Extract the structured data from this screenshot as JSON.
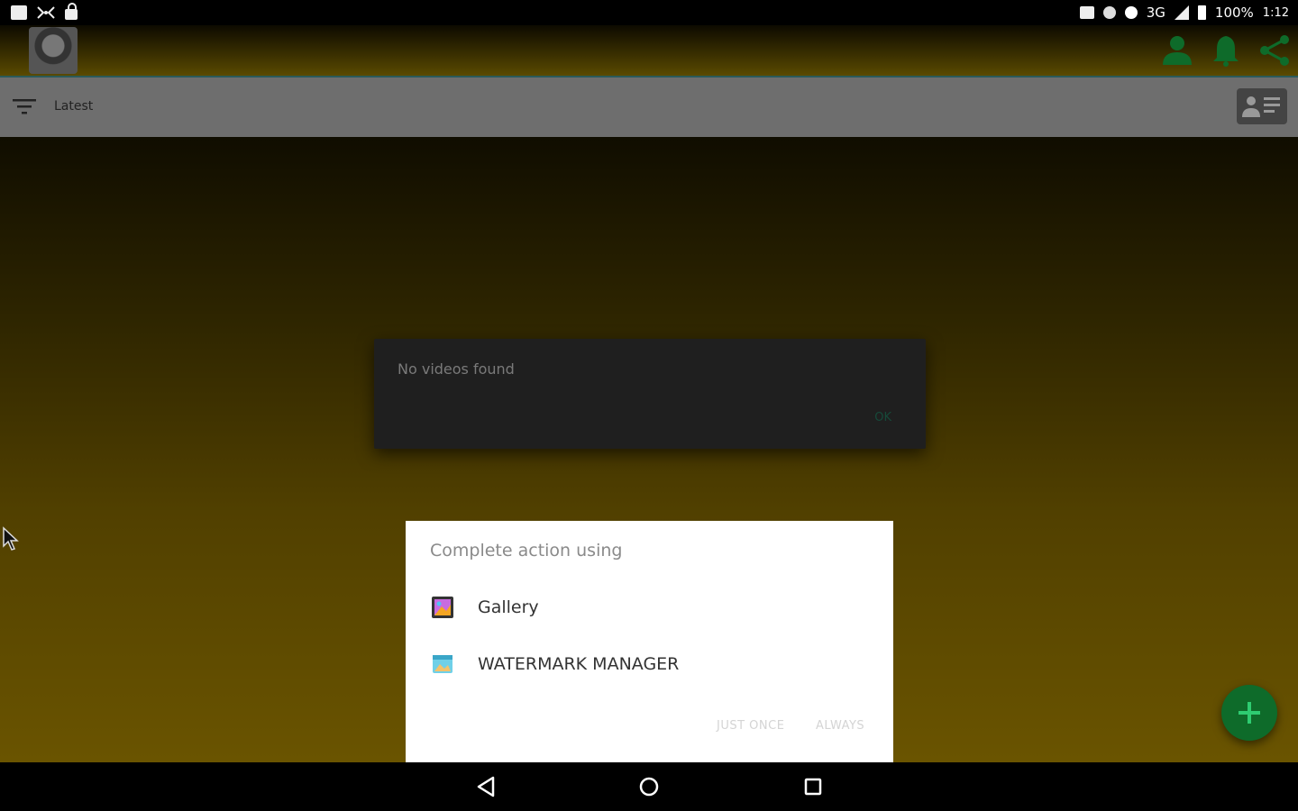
{
  "status_bar": {
    "network": "3G",
    "battery": "100%",
    "time": "1:12"
  },
  "filter_bar": {
    "sort_label": "Latest"
  },
  "alert": {
    "message": "No videos found",
    "ok_label": "OK"
  },
  "chooser": {
    "title": "Complete action using",
    "items": [
      {
        "label": "Gallery",
        "icon": "gallery-app-icon"
      },
      {
        "label": "WATERMARK MANAGER",
        "icon": "watermark-manager-app-icon"
      }
    ],
    "just_once_label": "JUST ONCE",
    "always_label": "ALWAYS"
  },
  "colors": {
    "accent_green": "#0e6b2a",
    "chooser_bg": "#ffffff",
    "dialog_bg": "#1f1f1f"
  }
}
